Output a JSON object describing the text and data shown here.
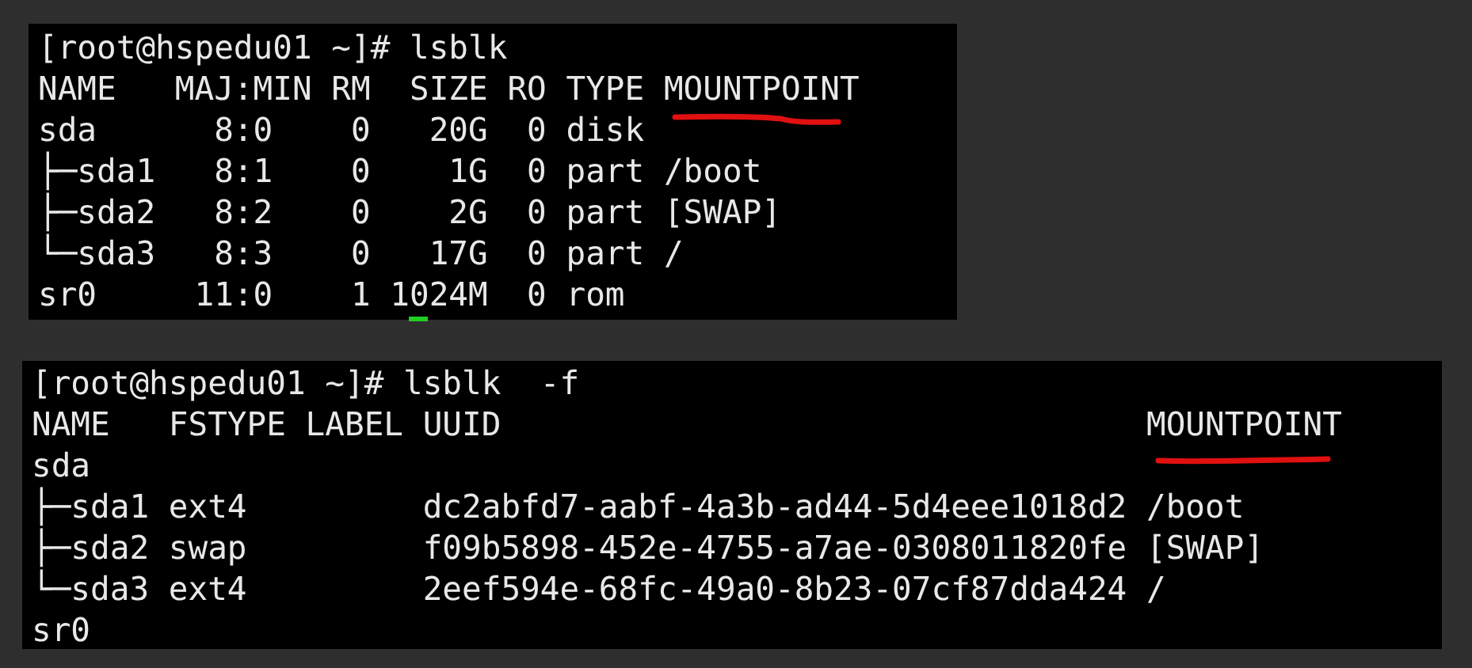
{
  "terminals": [
    {
      "lines": [
        "[root@hspedu01 ~]# lsblk",
        "NAME   MAJ:MIN RM  SIZE RO TYPE MOUNTPOINT",
        "sda      8:0    0   20G  0 disk",
        "├─sda1   8:1    0    1G  0 part /boot",
        "├─sda2   8:2    0    2G  0 part [SWAP]",
        "└─sda3   8:3    0   17G  0 part /",
        "sr0     11:0    1 1024M  0 rom"
      ]
    },
    {
      "lines": [
        "[root@hspedu01 ~]# lsblk  -f",
        "NAME   FSTYPE LABEL UUID                                 MOUNTPOINT",
        "sda",
        "├─sda1 ext4         dc2abfd7-aabf-4a3b-ad44-5d4eee1018d2 /boot",
        "├─sda2 swap         f09b5898-452e-4755-a7ae-0308011820fe [SWAP]",
        "└─sda3 ext4         2eef594e-68fc-49a0-8b23-07cf87dda424 /",
        "sr0"
      ]
    }
  ]
}
